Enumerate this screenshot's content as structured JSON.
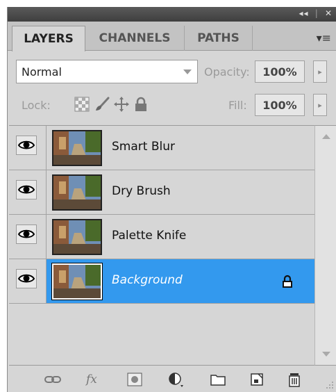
{
  "window": {
    "title_controls": {
      "collapse": "◂◂",
      "separator": "|",
      "close": "✕"
    }
  },
  "tabs": [
    {
      "label": "LAYERS",
      "active": true
    },
    {
      "label": "CHANNELS",
      "active": false
    },
    {
      "label": "PATHS",
      "active": false
    }
  ],
  "panel_menu_glyph": "▾≡",
  "blend": {
    "mode": "Normal"
  },
  "opacity": {
    "label": "Opacity:",
    "value": "100%"
  },
  "lock": {
    "label": "Lock:",
    "icons": [
      "lock-transparent-icon",
      "lock-paint-icon",
      "lock-position-icon",
      "lock-all-icon"
    ]
  },
  "fill": {
    "label": "Fill:",
    "value": "100%"
  },
  "flyout_glyph": "▸",
  "layers": [
    {
      "name": "Smart Blur",
      "visible": true,
      "selected": false,
      "locked": false
    },
    {
      "name": "Dry Brush",
      "visible": true,
      "selected": false,
      "locked": false
    },
    {
      "name": "Palette Knife",
      "visible": true,
      "selected": false,
      "locked": false
    },
    {
      "name": "Background",
      "visible": true,
      "selected": true,
      "locked": true
    }
  ],
  "footer_icons": [
    "link-layers-icon",
    "fx-icon",
    "layer-mask-icon",
    "adjustment-layer-icon",
    "new-group-icon",
    "new-layer-icon",
    "trash-icon"
  ],
  "colors": {
    "selected": "#3399ee",
    "panel": "#d6d6d6"
  }
}
